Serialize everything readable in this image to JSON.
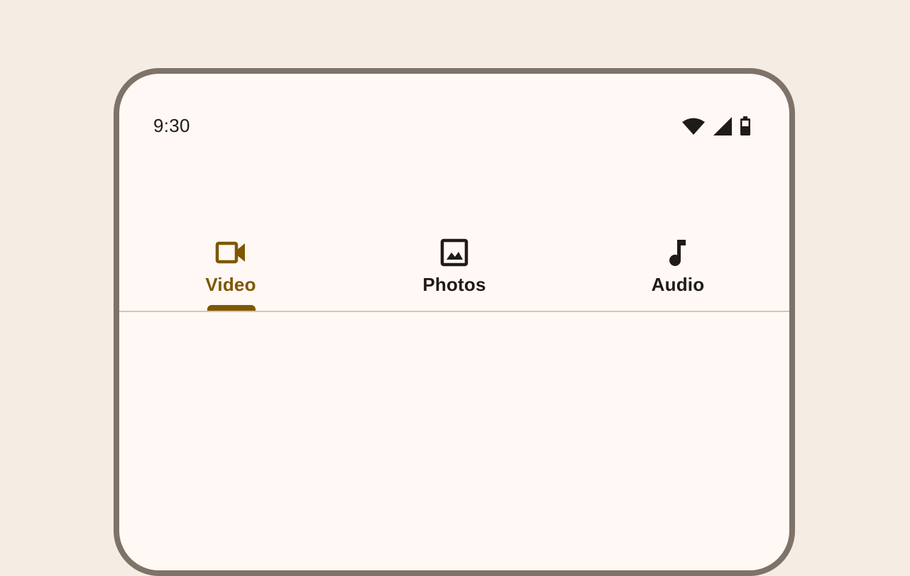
{
  "status_bar": {
    "time": "9:30",
    "icons": [
      "wifi-icon",
      "cellular-signal-icon",
      "battery-icon"
    ]
  },
  "tabs": [
    {
      "label": "Video",
      "icon": "videocam-icon",
      "selected": true
    },
    {
      "label": "Photos",
      "icon": "image-icon",
      "selected": false
    },
    {
      "label": "Audio",
      "icon": "music-note-icon",
      "selected": false
    }
  ],
  "colors": {
    "background": "#f5ece3",
    "surface": "#fff8f4",
    "device_frame": "#7f7268",
    "primary": "#7e5700",
    "on_surface": "#1f1b16",
    "divider": "#d6c4b2"
  }
}
